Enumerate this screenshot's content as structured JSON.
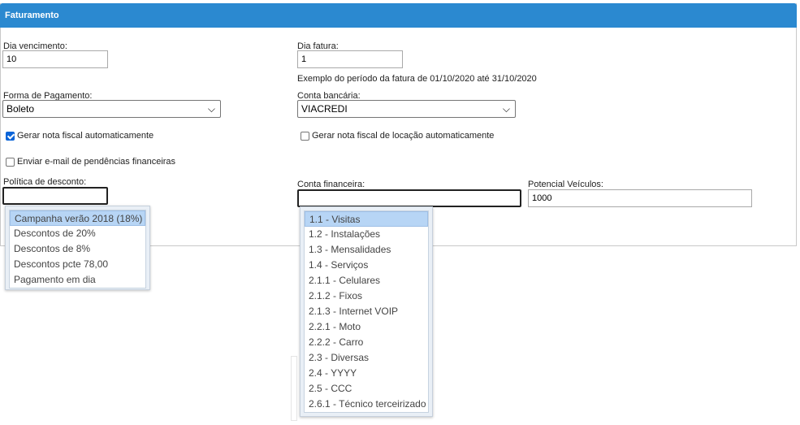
{
  "header": {
    "title": "Faturamento"
  },
  "fields": {
    "dia_vencimento": {
      "label": "Dia vencimento:",
      "value": "10"
    },
    "dia_fatura": {
      "label": "Dia fatura:",
      "value": "1"
    },
    "periodo_exemplo": "Exemplo do período da fatura de 01/10/2020 até 31/10/2020",
    "forma_pagamento": {
      "label": "Forma de Pagamento:",
      "value": "Boleto"
    },
    "conta_bancaria": {
      "label": "Conta bancária:",
      "value": "VIACREDI"
    },
    "gerar_nota": {
      "label": "Gerar nota fiscal automaticamente",
      "checked": true
    },
    "gerar_nota_locacao": {
      "label": "Gerar nota fiscal de locação automaticamente",
      "checked": false
    },
    "enviar_email": {
      "label": "Enviar e-mail de pendências financeiras",
      "checked": false
    },
    "politica_desconto": {
      "label": "Política de desconto:",
      "value": ""
    },
    "conta_financeira": {
      "label": "Conta financeira:",
      "value": ""
    },
    "potencial_veiculos": {
      "label": "Potencial Veículos:",
      "value": "1000"
    }
  },
  "discount_dropdown": {
    "options": [
      "Campanha verão 2018 (18%)",
      "Descontos de 20%",
      "Descontos de 8%",
      "Descontos pcte 78,00",
      "Pagamento em dia"
    ],
    "highlighted": 0
  },
  "account_dropdown": {
    "options": [
      "1.1 - Visitas",
      "1.2 - Instalações",
      "1.3 - Mensalidades",
      "1.4 - Serviços",
      "2.1.1 - Celulares",
      "2.1.2 - Fixos",
      "2.1.3 - Internet VOIP",
      "2.2.1 - Moto",
      "2.2.2 - Carro",
      "2.3 - Diversas",
      "2.4 - YYYY",
      "2.5 - CCC",
      "2.6.1 - Técnico terceirizado"
    ],
    "highlighted": 0
  },
  "icons": {
    "select_arrow": "chevron-down-icon",
    "checkbox": "check-icon"
  },
  "colors": {
    "header_bg": "#2b89d0",
    "highlight": "#b7d5f5",
    "checkbox_checked": "#0a64d8"
  }
}
